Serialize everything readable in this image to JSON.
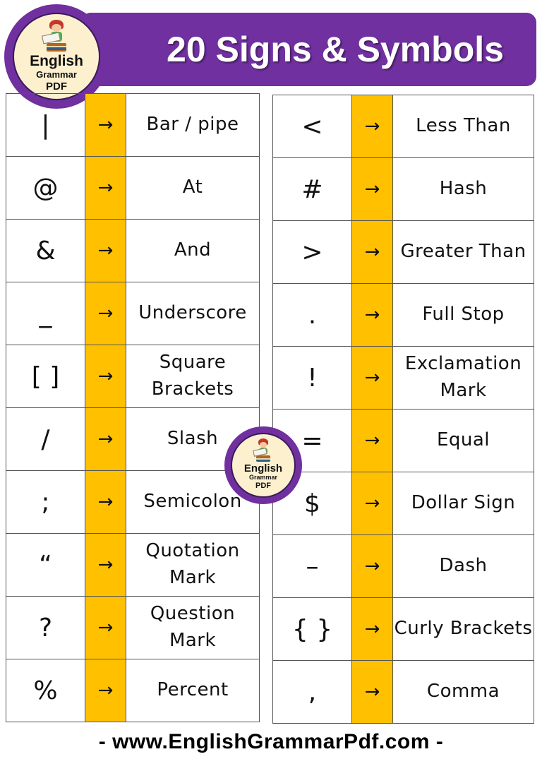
{
  "header": {
    "title": "20 Signs & Symbols"
  },
  "logo": {
    "line1": "English",
    "line2": "Grammar",
    "line3": "PDF",
    "icon": "girl-reading-books-icon"
  },
  "arrow": "→",
  "left_table": [
    {
      "symbol": "|",
      "name": "Bar / pipe"
    },
    {
      "symbol": "@",
      "name": "At"
    },
    {
      "symbol": "&",
      "name": "And"
    },
    {
      "symbol": "_",
      "name": "Underscore"
    },
    {
      "symbol": "[ ]",
      "name": "Square Brackets"
    },
    {
      "symbol": "/",
      "name": "Slash"
    },
    {
      "symbol": ";",
      "name": "Semicolon"
    },
    {
      "symbol": "“",
      "name": "Quotation Mark"
    },
    {
      "symbol": "?",
      "name": "Question Mark"
    },
    {
      "symbol": "%",
      "name": "Percent"
    }
  ],
  "right_table": [
    {
      "symbol": "<",
      "name": "Less Than"
    },
    {
      "symbol": "#",
      "name": "Hash"
    },
    {
      "symbol": ">",
      "name": "Greater Than"
    },
    {
      "symbol": ".",
      "name": "Full Stop"
    },
    {
      "symbol": "!",
      "name": "Exclamation Mark"
    },
    {
      "symbol": "=",
      "name": "Equal"
    },
    {
      "symbol": "$",
      "name": "Dollar Sign"
    },
    {
      "symbol": "–",
      "name": "Dash"
    },
    {
      "symbol": "{ }",
      "name": "Curly Brackets"
    },
    {
      "symbol": ",",
      "name": "Comma"
    }
  ],
  "footer": {
    "text": "- www.EnglishGrammarPdf.com -"
  },
  "colors": {
    "banner": "#7030a0",
    "arrow_column": "#ffc000",
    "logo_fill": "#fdf0cf"
  }
}
